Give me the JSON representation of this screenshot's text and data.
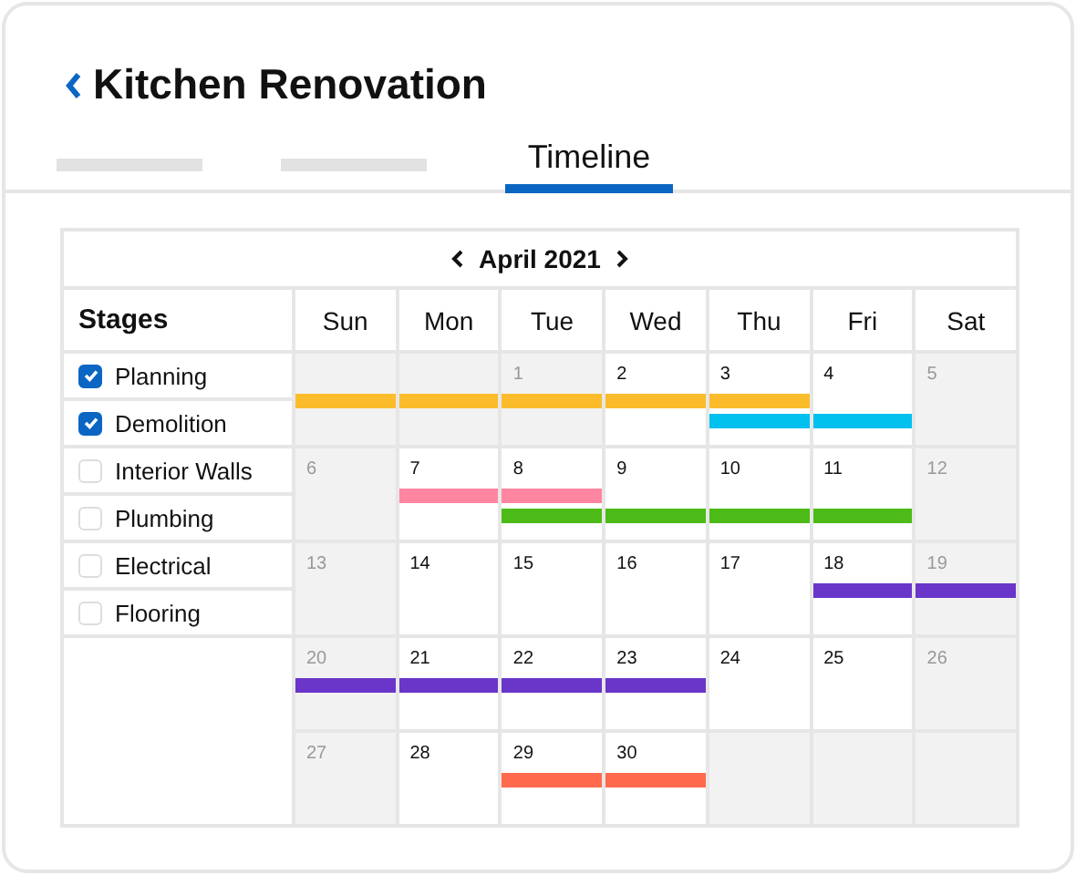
{
  "header": {
    "title": "Kitchen Renovation"
  },
  "tabs": [
    {
      "selected": false
    },
    {
      "selected": false
    },
    {
      "label": "Timeline",
      "selected": true
    }
  ],
  "calendar": {
    "month": "April 2021",
    "stages_heading": "Stages",
    "weekdays": [
      "Sun",
      "Mon",
      "Tue",
      "Wed",
      "Thu",
      "Fri",
      "Sat"
    ],
    "stages": [
      {
        "label": "Planning",
        "checked": true
      },
      {
        "label": "Demolition",
        "checked": true
      },
      {
        "label": "Interior Walls",
        "checked": false
      },
      {
        "label": "Plumbing",
        "checked": false
      },
      {
        "label": "Electrical",
        "checked": false
      },
      {
        "label": "Flooring",
        "checked": false
      }
    ],
    "weeks": [
      {
        "days": [
          {
            "kind": "blank",
            "bars": [
              {
                "kind": "bar",
                "color": "#fbbc2c"
              }
            ]
          },
          {
            "kind": "blank",
            "bars": [
              {
                "kind": "bar",
                "color": "#fbbc2c"
              }
            ]
          },
          {
            "kind": "muted",
            "day": "1",
            "bars": [
              {
                "kind": "bar",
                "color": "#fbbc2c"
              }
            ]
          },
          {
            "kind": "normal",
            "day": "2",
            "bars": [
              {
                "kind": "bar",
                "color": "#fbbc2c"
              }
            ]
          },
          {
            "kind": "normal",
            "day": "3",
            "bars": [
              {
                "kind": "bar",
                "color": "#fbbc2c"
              },
              {
                "kind": "bar",
                "color": "#00c0ee"
              }
            ]
          },
          {
            "kind": "normal",
            "day": "4",
            "bars": [
              {
                "kind": "spacer"
              },
              {
                "kind": "bar",
                "color": "#00c0ee"
              }
            ]
          },
          {
            "kind": "muted",
            "day": "5"
          }
        ]
      },
      {
        "days": [
          {
            "kind": "muted",
            "day": "6"
          },
          {
            "kind": "normal",
            "day": "7",
            "bars": [
              {
                "kind": "bar",
                "color": "#ff85a1"
              }
            ]
          },
          {
            "kind": "normal",
            "day": "8",
            "bars": [
              {
                "kind": "bar",
                "color": "#ff85a1"
              },
              {
                "kind": "bar",
                "color": "#4cbb17"
              }
            ]
          },
          {
            "kind": "normal",
            "day": "9",
            "bars": [
              {
                "kind": "spacer"
              },
              {
                "kind": "bar",
                "color": "#4cbb17"
              }
            ]
          },
          {
            "kind": "normal",
            "day": "10",
            "bars": [
              {
                "kind": "spacer"
              },
              {
                "kind": "bar",
                "color": "#4cbb17"
              }
            ]
          },
          {
            "kind": "normal",
            "day": "11",
            "bars": [
              {
                "kind": "spacer"
              },
              {
                "kind": "bar",
                "color": "#4cbb17"
              }
            ]
          },
          {
            "kind": "muted",
            "day": "12"
          }
        ]
      },
      {
        "days": [
          {
            "kind": "muted",
            "day": "13"
          },
          {
            "kind": "normal",
            "day": "14"
          },
          {
            "kind": "normal",
            "day": "15"
          },
          {
            "kind": "normal",
            "day": "16"
          },
          {
            "kind": "normal",
            "day": "17"
          },
          {
            "kind": "normal",
            "day": "18",
            "bars": [
              {
                "kind": "bar",
                "color": "#6a35c9"
              }
            ]
          },
          {
            "kind": "muted",
            "day": "19",
            "bars": [
              {
                "kind": "bar",
                "color": "#6a35c9"
              }
            ]
          }
        ]
      },
      {
        "days": [
          {
            "kind": "muted",
            "day": "20",
            "bars": [
              {
                "kind": "bar",
                "color": "#6a35c9"
              }
            ]
          },
          {
            "kind": "normal",
            "day": "21",
            "bars": [
              {
                "kind": "bar",
                "color": "#6a35c9"
              }
            ]
          },
          {
            "kind": "normal",
            "day": "22",
            "bars": [
              {
                "kind": "bar",
                "color": "#6a35c9"
              }
            ]
          },
          {
            "kind": "normal",
            "day": "23",
            "bars": [
              {
                "kind": "bar",
                "color": "#6a35c9"
              }
            ]
          },
          {
            "kind": "normal",
            "day": "24"
          },
          {
            "kind": "normal",
            "day": "25"
          },
          {
            "kind": "muted",
            "day": "26"
          }
        ]
      },
      {
        "days": [
          {
            "kind": "muted",
            "day": "27"
          },
          {
            "kind": "normal",
            "day": "28"
          },
          {
            "kind": "normal",
            "day": "29",
            "bars": [
              {
                "kind": "bar",
                "color": "#ff6a4d"
              }
            ]
          },
          {
            "kind": "normal",
            "day": "30",
            "bars": [
              {
                "kind": "bar",
                "color": "#ff6a4d"
              }
            ]
          },
          {
            "kind": "blank"
          },
          {
            "kind": "blank"
          },
          {
            "kind": "blank"
          }
        ]
      }
    ]
  }
}
